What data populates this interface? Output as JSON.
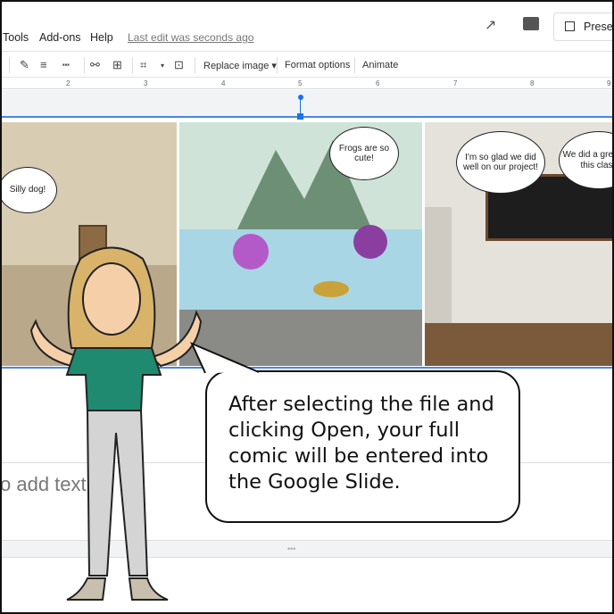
{
  "menu": {
    "items": [
      "Tools",
      "Add-ons",
      "Help"
    ],
    "last_edit": "Last edit was seconds ago"
  },
  "header": {
    "present_label": "Prese",
    "activity_icon": "trending-up-icon",
    "comments_icon": "comment-icon"
  },
  "toolbar": {
    "replace_image": "Replace image ▾",
    "format_options": "Format options",
    "animate": "Animate"
  },
  "ruler": {
    "ticks": [
      "2",
      "3",
      "4",
      "5",
      "6",
      "7",
      "8",
      "9"
    ]
  },
  "comic": {
    "panel1": {
      "bubble": "Silly dog!"
    },
    "panel2": {
      "bubble": "Frogs are so cute!"
    },
    "panel3": {
      "bubble1": "I'm so glad we did well on our project!",
      "bubble2": "We did a great job this class"
    }
  },
  "notes": {
    "placeholder": "o add text"
  },
  "callout": {
    "text": "After selecting the file and clicking Open, your full comic will be entered into the Google Slide."
  },
  "colors": {
    "accent": "#1a73e8",
    "shirt": "#1f8a70"
  }
}
